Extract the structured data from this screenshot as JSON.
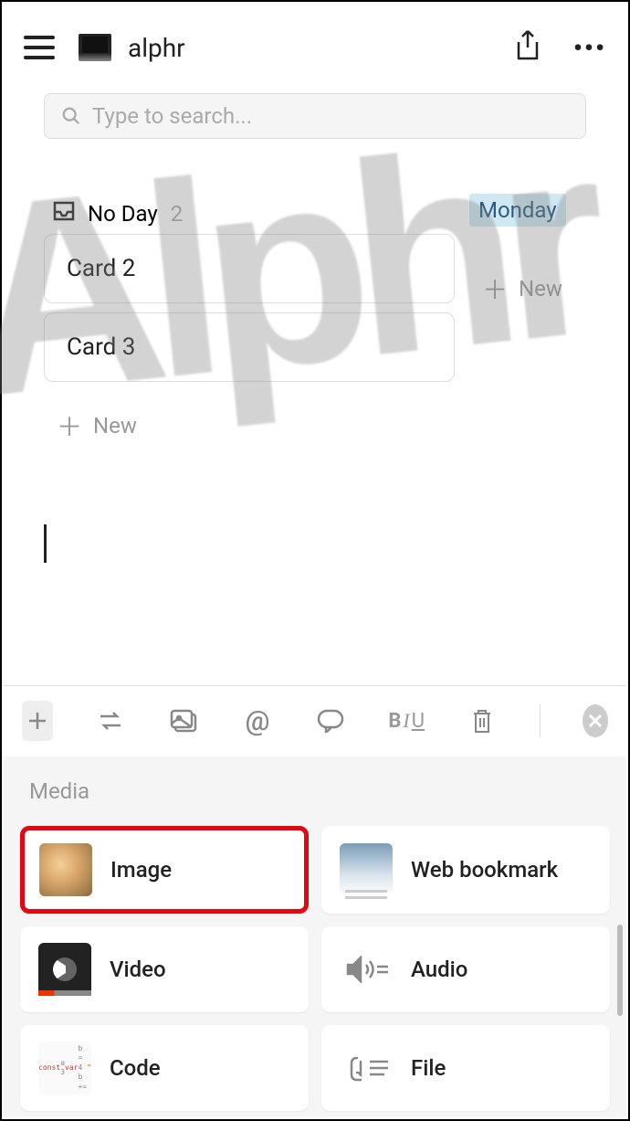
{
  "header": {
    "title": "alphr"
  },
  "search": {
    "placeholder": "Type to search..."
  },
  "board": {
    "column1": {
      "title": "No Day",
      "count": "2",
      "cards": [
        "Card 2",
        "Card 3"
      ],
      "new_label": "New"
    },
    "column2": {
      "title": "Monday",
      "new_label": "New"
    }
  },
  "media": {
    "section_label": "Media",
    "items": {
      "image": "Image",
      "web_bookmark": "Web bookmark",
      "video": "Video",
      "audio": "Audio",
      "code": "Code",
      "file": "File"
    }
  },
  "watermark": "Alphr"
}
